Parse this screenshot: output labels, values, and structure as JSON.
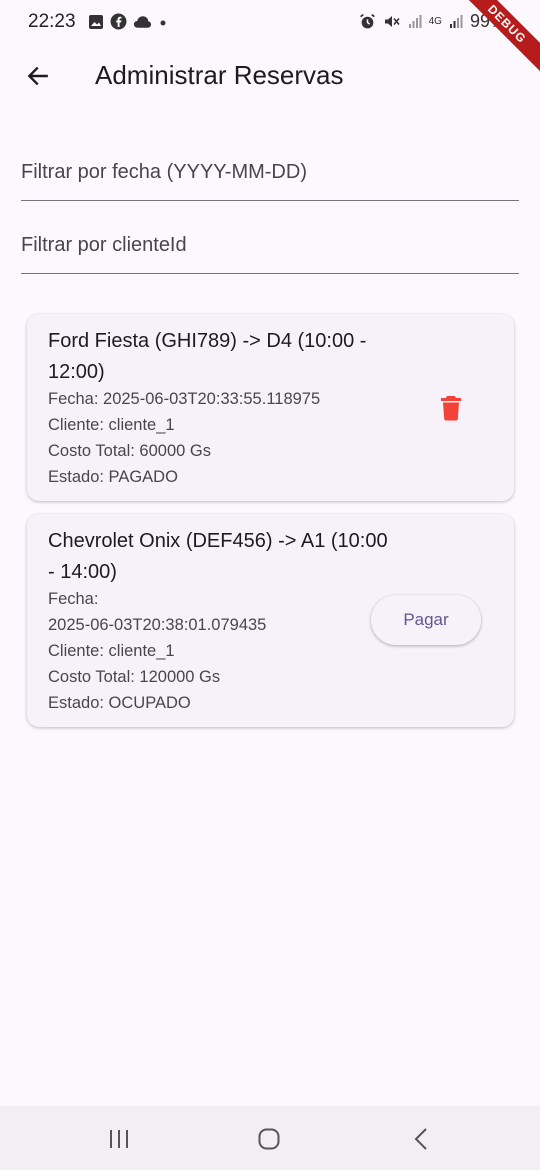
{
  "status_bar": {
    "time": "22:23",
    "battery": "99%",
    "network": "4G",
    "debug_label": "DEBUG"
  },
  "app_bar": {
    "title": "Administrar Reservas"
  },
  "filters": {
    "date_placeholder": "Filtrar por fecha (YYYY-MM-DD)",
    "client_placeholder": "Filtrar por clienteId"
  },
  "reservations": [
    {
      "title": "Ford Fiesta (GHI789) -> D4 (10:00 - 12:00)",
      "fecha": "Fecha: 2025-06-03T20:33:55.118975",
      "cliente": "Cliente: cliente_1",
      "costo": "Costo Total: 60000 Gs",
      "estado": "Estado: PAGADO"
    },
    {
      "title": "Chevrolet Onix (DEF456) -> A1 (10:00 - 14:00)",
      "fecha_label": "Fecha:",
      "fecha_value": "2025-06-03T20:38:01.079435",
      "cliente": "Cliente: cliente_1",
      "costo": "Costo Total: 120000 Gs",
      "estado": "Estado: OCUPADO",
      "action_label": "Pagar"
    }
  ],
  "colors": {
    "background": "#fdf7fe",
    "card": "#f7f2fa",
    "delete_icon": "#f44336",
    "button_text": "#65558f"
  },
  "icons": {
    "back": "arrow-left-icon",
    "delete": "trash-icon",
    "nav_recents": "recents-icon",
    "nav_home": "home-icon",
    "nav_back": "back-chevron-icon"
  }
}
